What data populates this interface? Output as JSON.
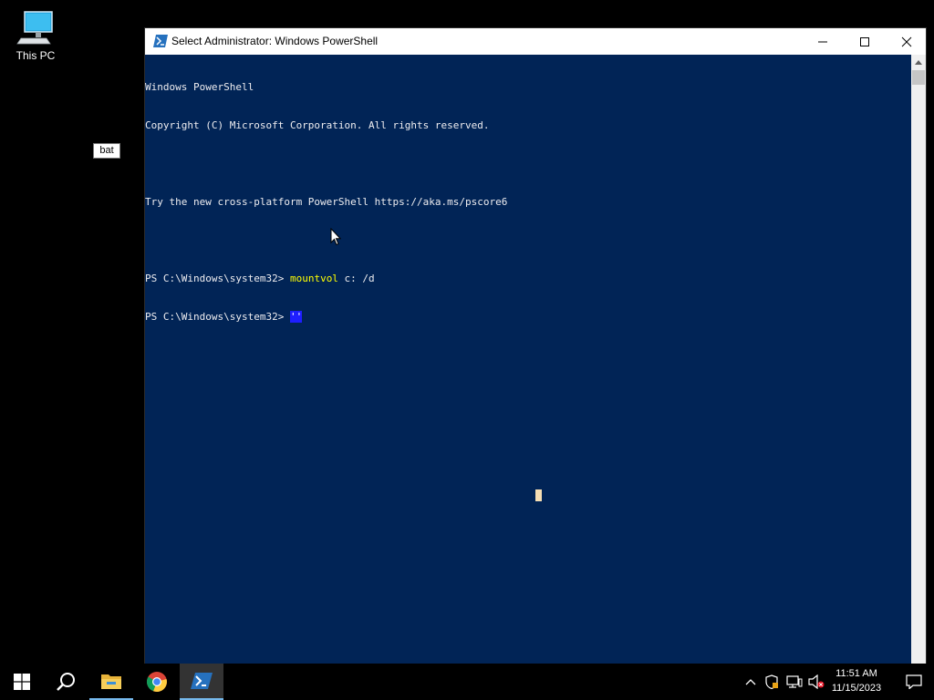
{
  "desktop": {
    "icons": [
      {
        "label": "This PC",
        "icon": "this-pc-icon"
      }
    ],
    "tooltip": "bat"
  },
  "window": {
    "title": "Select Administrator: Windows PowerShell",
    "buttons": {
      "minimize": "minimize-icon",
      "maximize": "maximize-icon",
      "close": "close-icon"
    }
  },
  "console": {
    "lines": [
      "Windows PowerShell",
      "Copyright (C) Microsoft Corporation. All rights reserved.",
      "",
      "Try the new cross-platform PowerShell https://aka.ms/pscore6",
      ""
    ],
    "prompt1": "PS C:\\Windows\\system32> ",
    "command1": "mountvol",
    "command1_args": " c: /d",
    "prompt2": "PS C:\\Windows\\system32> ",
    "command2": "''"
  },
  "taskbar": {
    "items": [
      "start-icon",
      "search-icon",
      "file-explorer-icon",
      "chrome-icon",
      "powershell-icon"
    ],
    "clock": {
      "time": "11:51 AM",
      "date": "11/15/2023"
    }
  }
}
